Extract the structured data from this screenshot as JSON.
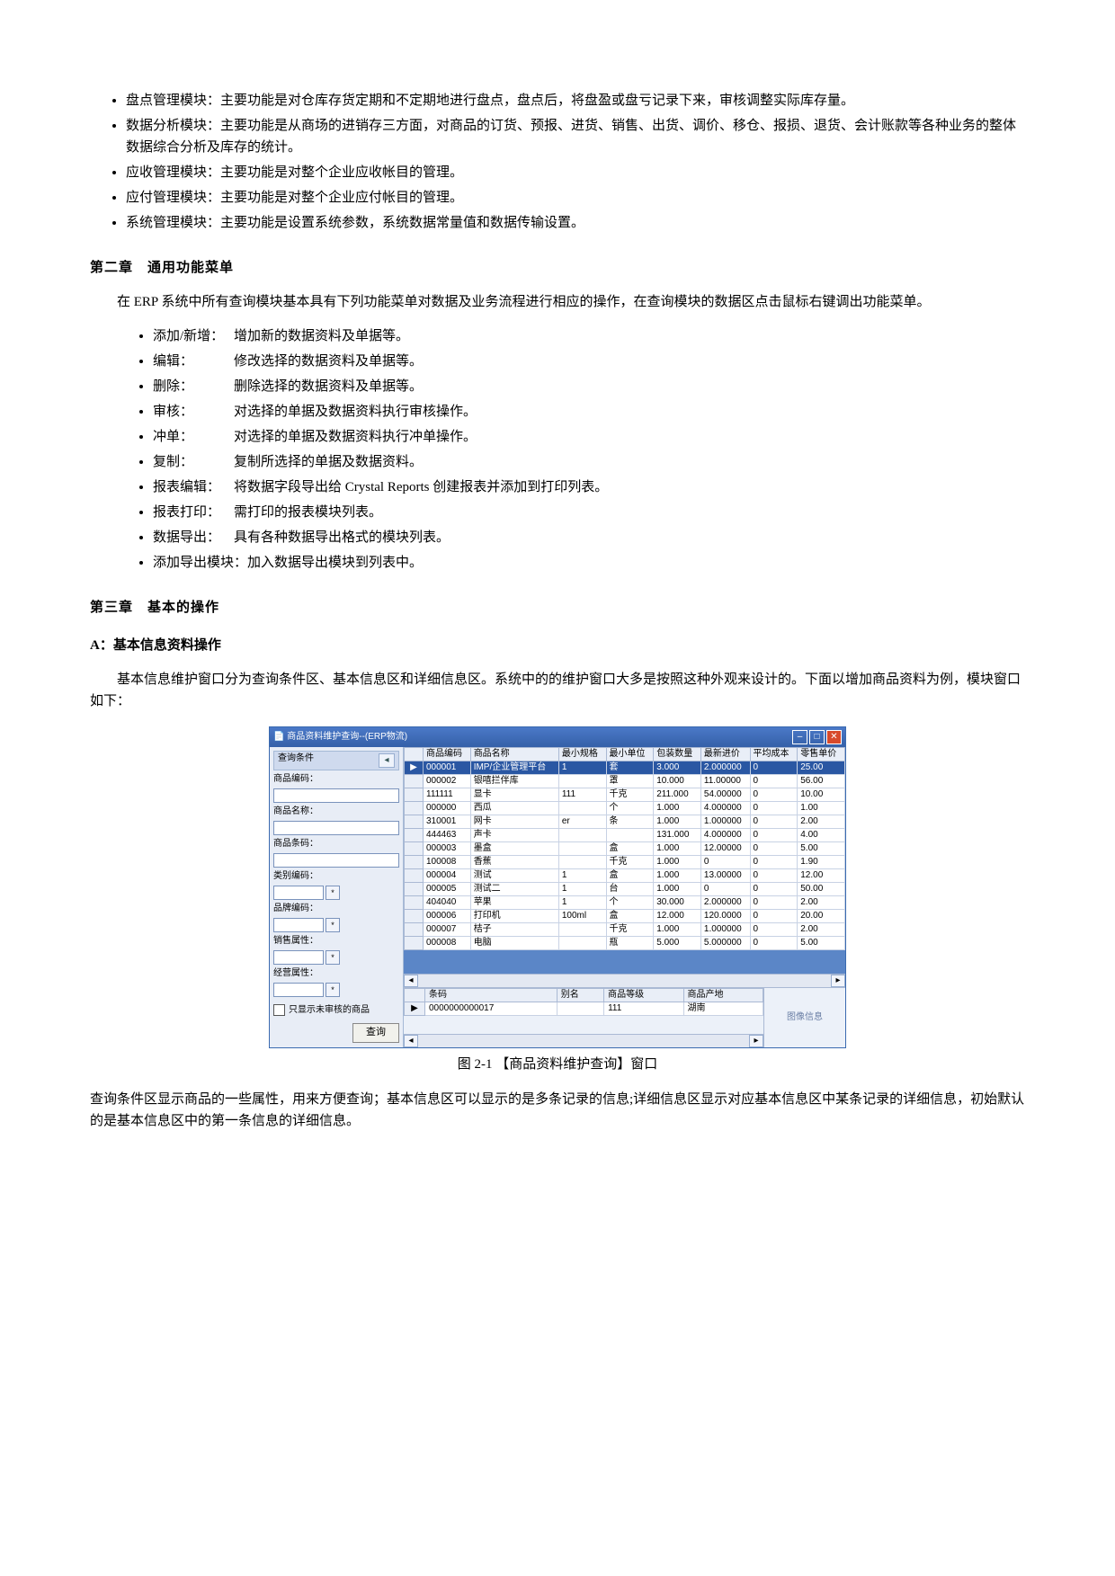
{
  "moduleBullets": [
    "盘点管理模块：主要功能是对仓库存货定期和不定期地进行盘点，盘点后，将盘盈或盘亏记录下来，审核调整实际库存量。",
    "数据分析模块：主要功能是从商场的进销存三方面，对商品的订货、预报、进货、销售、出货、调价、移仓、报损、退货、会计账款等各种业务的整体数据综合分析及库存的统计。",
    "应收管理模块：主要功能是对整个企业应收帐目的管理。",
    "应付管理模块：主要功能是对整个企业应付帐目的管理。",
    "系统管理模块：主要功能是设置系统参数，系统数据常量值和数据传输设置。"
  ],
  "chapter2Title": "第二章　通用功能菜单",
  "chapter2Intro": "在 ERP 系统中所有查询模块基本具有下列功能菜单对数据及业务流程进行相应的操作，在查询模块的数据区点击鼠标右键调出功能菜单。",
  "menu": [
    {
      "term": "添加/新增：",
      "desc": "增加新的数据资料及单据等。"
    },
    {
      "term": "编辑：",
      "desc": "修改选择的数据资料及单据等。"
    },
    {
      "term": "删除：",
      "desc": "删除选择的数据资料及单据等。"
    },
    {
      "term": "审核：",
      "desc": "对选择的单据及数据资料执行审核操作。"
    },
    {
      "term": "冲单：",
      "desc": "对选择的单据及数据资料执行冲单操作。"
    },
    {
      "term": "复制：",
      "desc": "复制所选择的单据及数据资料。"
    },
    {
      "term": "报表编辑：",
      "desc": "将数据字段导出给 Crystal Reports 创建报表并添加到打印列表。"
    },
    {
      "term": "报表打印：",
      "desc": "需打印的报表模块列表。"
    },
    {
      "term": "数据导出：",
      "desc": "具有各种数据导出格式的模块列表。"
    },
    {
      "term": "添加导出模块：",
      "desc": "加入数据导出模块到列表中。"
    }
  ],
  "chapter3Title": "第三章　基本的操作",
  "sectionA": "A：基本信息资料操作",
  "para3": "基本信息维护窗口分为查询条件区、基本信息区和详细信息区。系统中的的维护窗口大多是按照这种外观来设计的。下面以增加商品资料为例，模块窗口如下：",
  "figCaption": "图 2-1 【商品资料维护查询】窗口",
  "paraLast": "查询条件区显示商品的一些属性，用来方便查询；基本信息区可以显示的是多条记录的信息;详细信息区显示对应基本信息区中某条记录的详细信息，初始默认的是基本信息区中的第一条信息的详细信息。",
  "ss": {
    "title": "商品资料维护查询--(ERP物流)",
    "panelTitle": "查询条件",
    "labels": {
      "code": "商品编码：",
      "name": "商品名称：",
      "barcode": "商品条码：",
      "catCode": "类别编码：",
      "brandCode": "品牌编码：",
      "salesAttr": "销售属性：",
      "bizAttr": "经营属性：",
      "onlyUnreviewed": "只显示未审核的商品",
      "queryBtn": "查询",
      "imgInfo": "图像信息"
    },
    "headers": [
      "商品编码",
      "商品名称",
      "最小规格",
      "最小单位",
      "包装数量",
      "最新进价",
      "平均成本",
      "零售单价"
    ],
    "rows": [
      {
        "sel": true,
        "c": [
          "000001",
          "IMP/企业管理平台",
          "1",
          "套",
          "3.000",
          "2.000000",
          "0",
          "25.00"
        ]
      },
      {
        "c": [
          "000002",
          "银嘻拦伴库",
          "",
          "罩",
          "10.000",
          "11.00000",
          "0",
          "56.00"
        ]
      },
      {
        "c": [
          "111111",
          "显卡",
          "111",
          "千克",
          "211.000",
          "54.00000",
          "0",
          "10.00"
        ]
      },
      {
        "c": [
          "000000",
          "西瓜",
          "",
          "个",
          "1.000",
          "4.000000",
          "0",
          "1.00"
        ]
      },
      {
        "c": [
          "310001",
          "网卡",
          "er",
          "条",
          "1.000",
          "1.000000",
          "0",
          "2.00"
        ]
      },
      {
        "c": [
          "444463",
          "声卡",
          "",
          "",
          "131.000",
          "4.000000",
          "0",
          "4.00"
        ]
      },
      {
        "c": [
          "000003",
          "墨盒",
          "",
          "盒",
          "1.000",
          "12.00000",
          "0",
          "5.00"
        ]
      },
      {
        "c": [
          "100008",
          "香蕉",
          "",
          "千克",
          "1.000",
          "0",
          "0",
          "1.90"
        ]
      },
      {
        "c": [
          "000004",
          "测试",
          "1",
          "盒",
          "1.000",
          "13.00000",
          "0",
          "12.00"
        ]
      },
      {
        "c": [
          "000005",
          "测试二",
          "1",
          "台",
          "1.000",
          "0",
          "0",
          "50.00"
        ]
      },
      {
        "c": [
          "404040",
          "苹果",
          "1",
          "个",
          "30.000",
          "2.000000",
          "0",
          "2.00"
        ]
      },
      {
        "c": [
          "000006",
          "打印机",
          "100ml",
          "盒",
          "12.000",
          "120.0000",
          "0",
          "20.00"
        ]
      },
      {
        "c": [
          "000007",
          "桔子",
          "",
          "千克",
          "1.000",
          "1.000000",
          "0",
          "2.00"
        ]
      },
      {
        "c": [
          "000008",
          "电脑",
          "",
          "瓶",
          "5.000",
          "5.000000",
          "0",
          "5.00"
        ]
      }
    ],
    "detailHeaders": [
      "条码",
      "别名",
      "商品等级",
      "商品产地"
    ],
    "detailRow": [
      "0000000000017",
      "",
      "111",
      "湖南"
    ]
  }
}
